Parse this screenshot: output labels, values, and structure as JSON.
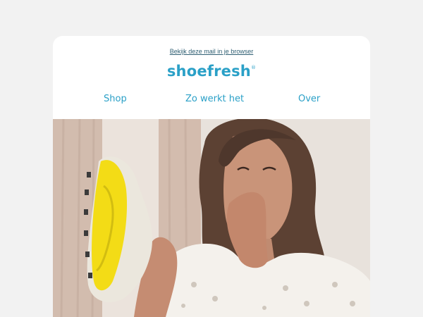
{
  "email": {
    "view_in_browser": "Bekijk deze mail in je browser",
    "brand": "shoefresh",
    "brand_mark": "®"
  },
  "nav": {
    "items": [
      {
        "label": "Shop"
      },
      {
        "label": "Zo werkt het"
      },
      {
        "label": "Over"
      }
    ]
  },
  "hero": {
    "image_alt": "",
    "colors": {
      "curtain": "#d6c2b5",
      "wall": "#e9e5df",
      "hair": "#5a4032",
      "skin": "#c99479",
      "blouse": "#f4f1ec",
      "shoe": "#f4dc15"
    }
  },
  "colors": {
    "background": "#f2f2f2",
    "accent": "#2aa0c7",
    "link": "#2f5f73"
  }
}
